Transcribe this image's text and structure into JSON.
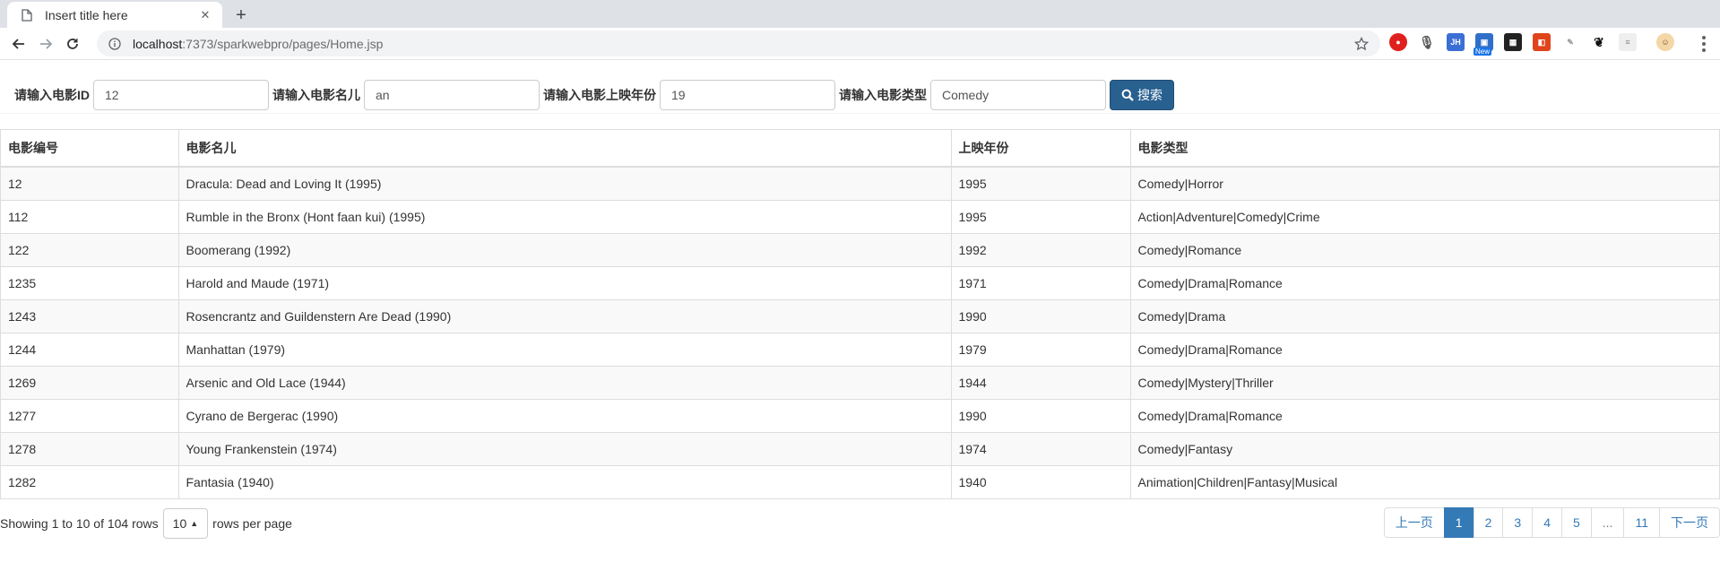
{
  "browser": {
    "tab_title": "Insert title here",
    "url_host": "localhost",
    "url_rest": ":7373/sparkwebpro/pages/Home.jsp",
    "extension_jh_label": "JH",
    "extension_new_badge": "New"
  },
  "search": {
    "id_label": "请输入电影ID",
    "id_value": "12",
    "name_label": "请输入电影名儿",
    "name_value": "an",
    "year_label": "请输入电影上映年份",
    "year_value": "19",
    "genre_label": "请输入电影类型",
    "genre_value": "Comedy",
    "button_label": "搜索"
  },
  "table": {
    "headers": [
      "电影编号",
      "电影名儿",
      "上映年份",
      "电影类型"
    ],
    "rows": [
      [
        "12",
        "Dracula: Dead and Loving It (1995)",
        "1995",
        "Comedy|Horror"
      ],
      [
        "112",
        "Rumble in the Bronx (Hont faan kui) (1995)",
        "1995",
        "Action|Adventure|Comedy|Crime"
      ],
      [
        "122",
        "Boomerang (1992)",
        "1992",
        "Comedy|Romance"
      ],
      [
        "1235",
        "Harold and Maude (1971)",
        "1971",
        "Comedy|Drama|Romance"
      ],
      [
        "1243",
        "Rosencrantz and Guildenstern Are Dead (1990)",
        "1990",
        "Comedy|Drama"
      ],
      [
        "1244",
        "Manhattan (1979)",
        "1979",
        "Comedy|Drama|Romance"
      ],
      [
        "1269",
        "Arsenic and Old Lace (1944)",
        "1944",
        "Comedy|Mystery|Thriller"
      ],
      [
        "1277",
        "Cyrano de Bergerac (1990)",
        "1990",
        "Comedy|Drama|Romance"
      ],
      [
        "1278",
        "Young Frankenstein (1974)",
        "1974",
        "Comedy|Fantasy"
      ],
      [
        "1282",
        "Fantasia (1940)",
        "1940",
        "Animation|Children|Fantasy|Musical"
      ]
    ]
  },
  "footer": {
    "showing_text": "Showing 1 to 10 of 104 rows",
    "page_size": "10",
    "rows_per_page_text": "rows per page",
    "pages": [
      "上一页",
      "1",
      "2",
      "3",
      "4",
      "5",
      "...",
      "11",
      "下一页"
    ],
    "active_page": "1"
  },
  "colors": {
    "primary": "#286090",
    "link": "#337ab7",
    "active_page": "#337ab7"
  }
}
